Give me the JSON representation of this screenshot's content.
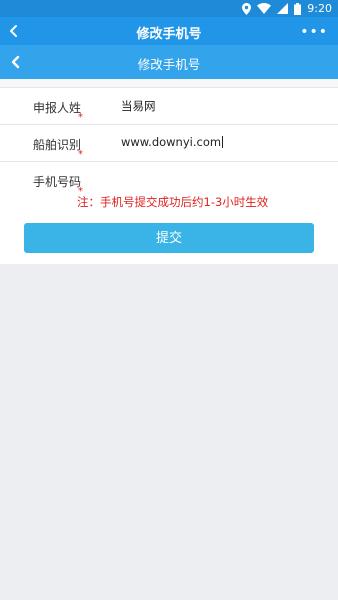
{
  "status_bar": {
    "time": "9:20"
  },
  "app_bar": {
    "title": "修改手机号",
    "menu_glyph": "•••"
  },
  "page_header": {
    "title": "修改手机号"
  },
  "form": {
    "fields": [
      {
        "label": "申报人姓",
        "required_mark": "*",
        "value": "当易网"
      },
      {
        "label": "船舶识别",
        "required_mark": "*",
        "value": "www.downyi.com"
      },
      {
        "label": "手机号码",
        "required_mark": "*",
        "value": ""
      }
    ],
    "note": "注：手机号提交成功后约1-3小时生效",
    "submit_label": "提交"
  },
  "colors": {
    "status_bar": "#1f8bd8",
    "app_bar": "#2196e8",
    "page_header": "#33a3ec",
    "submit_button": "#3ab4e6",
    "required_mark": "#e02020",
    "background": "#eceef2"
  },
  "icons": [
    "location-icon",
    "wifi-icon",
    "signal-icon",
    "battery-icon",
    "back-arrow-icon",
    "more-icon"
  ]
}
